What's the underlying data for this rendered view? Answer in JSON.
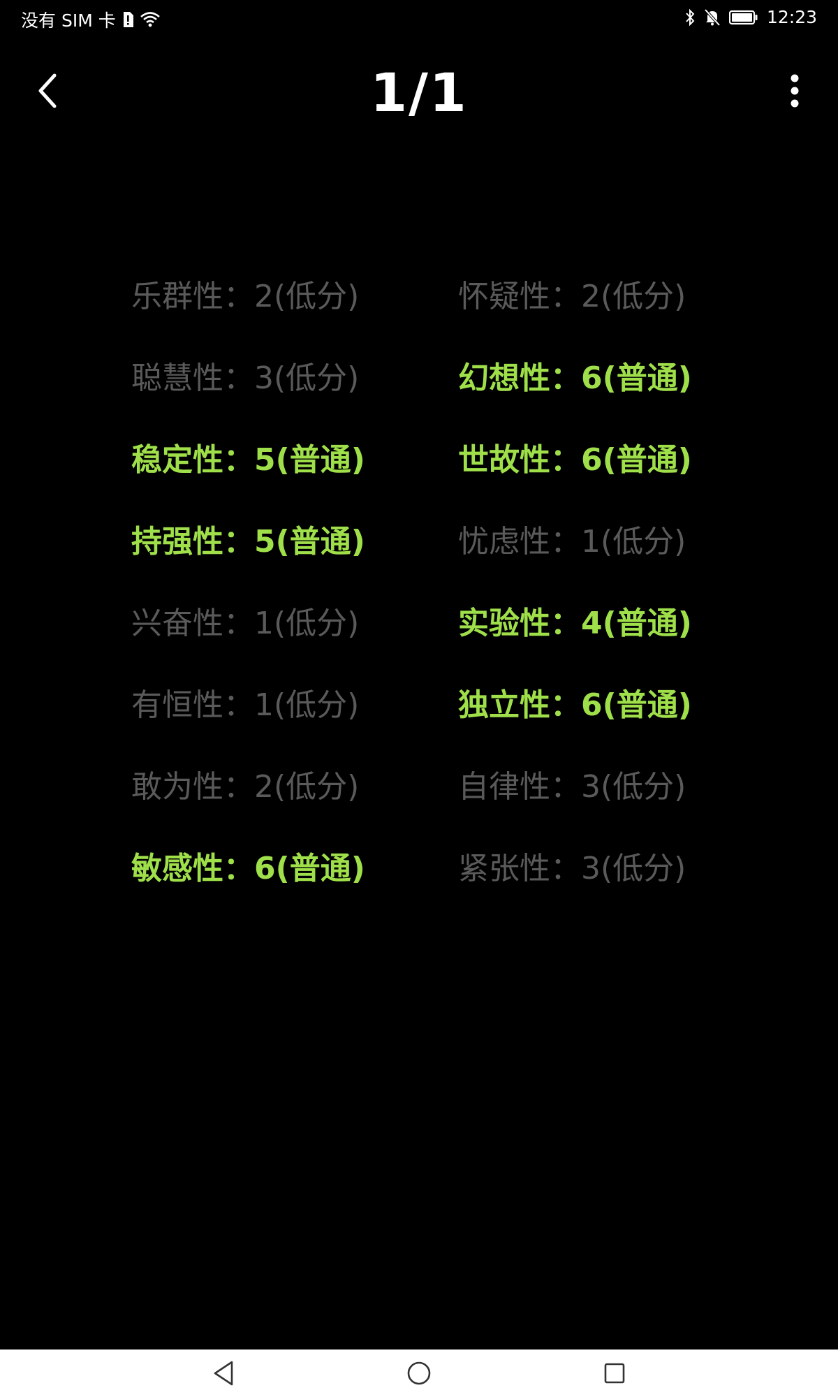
{
  "status_bar": {
    "carrier": "没有 SIM 卡",
    "time": "12:23"
  },
  "header": {
    "title": "1/1"
  },
  "results": [
    {
      "label": "乐群性：2(低分)",
      "level": "低分"
    },
    {
      "label": "怀疑性：2(低分)",
      "level": "低分"
    },
    {
      "label": "聪慧性：3(低分)",
      "level": "低分"
    },
    {
      "label": "幻想性：6(普通)",
      "level": "普通"
    },
    {
      "label": "稳定性：5(普通)",
      "level": "普通"
    },
    {
      "label": "世故性：6(普通)",
      "level": "普通"
    },
    {
      "label": "持强性：5(普通)",
      "level": "普通"
    },
    {
      "label": "忧虑性：1(低分)",
      "level": "低分"
    },
    {
      "label": "兴奋性：1(低分)",
      "level": "低分"
    },
    {
      "label": "实验性：4(普通)",
      "level": "普通"
    },
    {
      "label": "有恒性：1(低分)",
      "level": "低分"
    },
    {
      "label": "独立性：6(普通)",
      "level": "普通"
    },
    {
      "label": "敢为性：2(低分)",
      "level": "低分"
    },
    {
      "label": "自律性：3(低分)",
      "level": "低分"
    },
    {
      "label": "敏感性：6(普通)",
      "level": "普通"
    },
    {
      "label": "紧张性：3(低分)",
      "level": "低分"
    }
  ],
  "colors": {
    "normal": "#9fe04a",
    "low": "#5a5a5a",
    "background": "#000000"
  },
  "icons": {
    "back": "chevron-left-icon",
    "more": "more-vertical-icon",
    "nav_back": "triangle-back-icon",
    "nav_home": "circle-home-icon",
    "nav_recent": "square-recent-icon"
  }
}
